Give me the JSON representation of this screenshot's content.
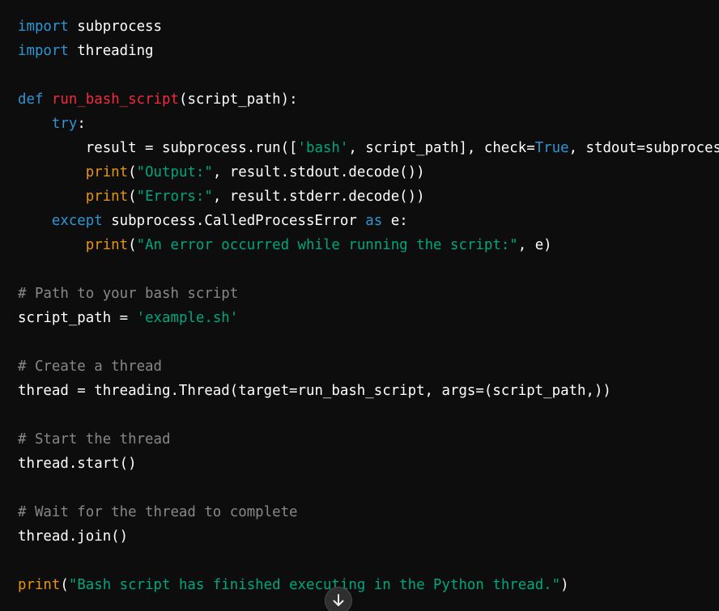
{
  "code_lines": [
    [
      {
        "t": "import",
        "c": "kw"
      },
      {
        "t": " subprocess",
        "c": ""
      }
    ],
    [
      {
        "t": "import",
        "c": "kw"
      },
      {
        "t": " threading",
        "c": ""
      }
    ],
    [],
    [
      {
        "t": "def",
        "c": "kw"
      },
      {
        "t": " ",
        "c": ""
      },
      {
        "t": "run_bash_script",
        "c": "fn"
      },
      {
        "t": "(script_path):",
        "c": ""
      }
    ],
    [
      {
        "t": "    ",
        "c": ""
      },
      {
        "t": "try",
        "c": "kw"
      },
      {
        "t": ":",
        "c": ""
      }
    ],
    [
      {
        "t": "        result = subprocess.run([",
        "c": ""
      },
      {
        "t": "'bash'",
        "c": "str"
      },
      {
        "t": ", script_path], check=",
        "c": ""
      },
      {
        "t": "True",
        "c": "bool"
      },
      {
        "t": ", stdout=subprocess.PIPE, stderr=subprocess.PIPE)",
        "c": ""
      }
    ],
    [
      {
        "t": "        ",
        "c": ""
      },
      {
        "t": "print",
        "c": "bi"
      },
      {
        "t": "(",
        "c": ""
      },
      {
        "t": "\"Output:\"",
        "c": "str"
      },
      {
        "t": ", result.stdout.decode())",
        "c": ""
      }
    ],
    [
      {
        "t": "        ",
        "c": ""
      },
      {
        "t": "print",
        "c": "bi"
      },
      {
        "t": "(",
        "c": ""
      },
      {
        "t": "\"Errors:\"",
        "c": "str"
      },
      {
        "t": ", result.stderr.decode())",
        "c": ""
      }
    ],
    [
      {
        "t": "    ",
        "c": ""
      },
      {
        "t": "except",
        "c": "kw"
      },
      {
        "t": " subprocess.CalledProcessError ",
        "c": ""
      },
      {
        "t": "as",
        "c": "kw"
      },
      {
        "t": " e:",
        "c": ""
      }
    ],
    [
      {
        "t": "        ",
        "c": ""
      },
      {
        "t": "print",
        "c": "bi"
      },
      {
        "t": "(",
        "c": ""
      },
      {
        "t": "\"An error occurred while running the script:\"",
        "c": "str"
      },
      {
        "t": ", e)",
        "c": ""
      }
    ],
    [],
    [
      {
        "t": "# Path to your bash script",
        "c": "cm"
      }
    ],
    [
      {
        "t": "script_path = ",
        "c": ""
      },
      {
        "t": "'example.sh'",
        "c": "str"
      }
    ],
    [],
    [
      {
        "t": "# Create a thread",
        "c": "cm"
      }
    ],
    [
      {
        "t": "thread = threading.Thread(target=run_bash_script, args=(script_path,))",
        "c": ""
      }
    ],
    [],
    [
      {
        "t": "# Start the thread",
        "c": "cm"
      }
    ],
    [
      {
        "t": "thread.start()",
        "c": ""
      }
    ],
    [],
    [
      {
        "t": "# Wait for the thread to complete",
        "c": "cm"
      }
    ],
    [
      {
        "t": "thread.join()",
        "c": ""
      }
    ],
    [],
    [
      {
        "t": "print",
        "c": "bi"
      },
      {
        "t": "(",
        "c": ""
      },
      {
        "t": "\"Bash script has finished executing in the Python thread.\"",
        "c": "str"
      },
      {
        "t": ")",
        "c": ""
      }
    ]
  ],
  "scroll_button": {
    "icon": "arrow-down-icon"
  },
  "colors": {
    "background": "#0d0d0d",
    "keyword": "#2e95d3",
    "function": "#f22c3d",
    "builtin": "#e9950c",
    "string": "#00a67d",
    "comment": "#b0b0b0",
    "text": "#ffffff"
  }
}
